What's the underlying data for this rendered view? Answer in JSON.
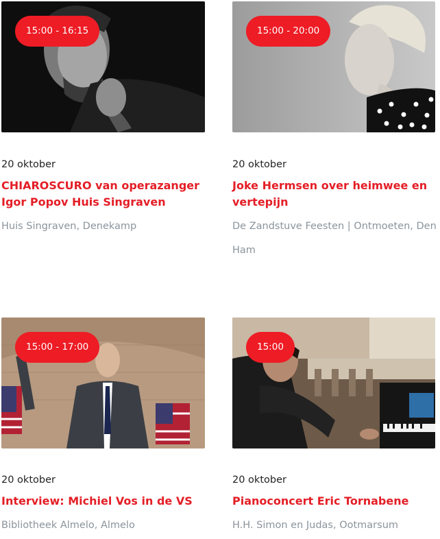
{
  "events": [
    {
      "time": "15:00 - 16:15",
      "date": "20 oktober",
      "title": "CHIAROSCURO van operazanger Igor Popov Huis Singraven",
      "location": "Huis Singraven, Denekamp"
    },
    {
      "time": "15:00 - 20:00",
      "date": "20 oktober",
      "title": "Joke Hermsen over heimwee en vertepijn",
      "location": "De Zandstuve Feesten | Ontmoeten, Den Ham"
    },
    {
      "time": "15:00 - 17:00",
      "date": "20 oktober",
      "title": "Interview: Michiel Vos in de VS",
      "location": "Bibliotheek Almelo, Almelo"
    },
    {
      "time": "15:00",
      "date": "20 oktober",
      "title": "Pianoconcert Eric Tornabene",
      "location": "H.H. Simon en Judas, Ootmarsum"
    }
  ]
}
